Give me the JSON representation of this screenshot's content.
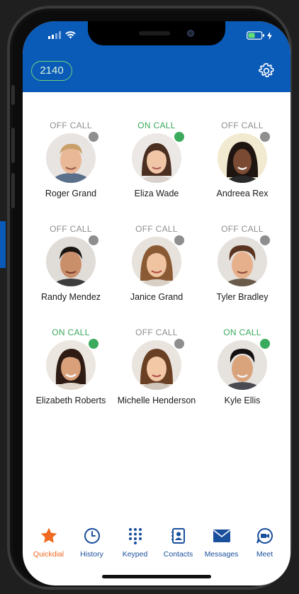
{
  "extension": "2140",
  "colors": {
    "header_bg": "#0a5ab8",
    "on_call": "#3aaa5c",
    "off_call": "#8e8e8e",
    "active_tab": "#ef6a20",
    "tab_icon": "#1a4f9c"
  },
  "contacts": [
    {
      "status": "OFF CALL",
      "name": "Roger Grand"
    },
    {
      "status": "ON CALL",
      "name": "Eliza Wade"
    },
    {
      "status": "OFF CALL",
      "name": "Andreea Rex"
    },
    {
      "status": "OFF CALL",
      "name": "Randy Mendez"
    },
    {
      "status": "OFF CALL",
      "name": "Janice Grand"
    },
    {
      "status": "OFF CALL",
      "name": "Tyler Bradley"
    },
    {
      "status": "ON CALL",
      "name": "Elizabeth Roberts"
    },
    {
      "status": "OFF CALL",
      "name": "Michelle Henderson"
    },
    {
      "status": "ON CALL",
      "name": "Kyle Ellis"
    }
  ],
  "tabs": [
    {
      "label": "Quickdial",
      "icon": "star-icon",
      "active": true
    },
    {
      "label": "History",
      "icon": "clock-icon",
      "active": false
    },
    {
      "label": "Keyped",
      "icon": "keypad-icon",
      "active": false
    },
    {
      "label": "Contacts",
      "icon": "contacts-icon",
      "active": false
    },
    {
      "label": "Messages",
      "icon": "envelope-icon",
      "active": false
    },
    {
      "label": "Meet",
      "icon": "video-icon",
      "active": false
    }
  ]
}
